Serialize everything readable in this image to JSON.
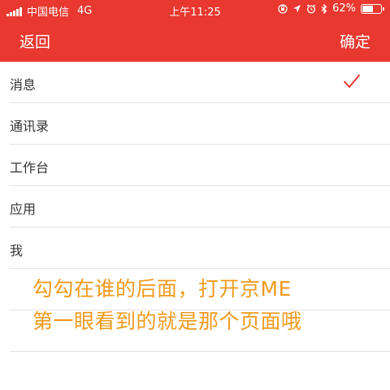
{
  "status_bar": {
    "carrier": "中国电信",
    "network": "4G",
    "time": "上午11:25",
    "battery": "62%",
    "battery_level": 0.62,
    "icons": [
      "signal-icon",
      "lock-rotation-icon",
      "location-icon",
      "alarm-icon",
      "bluetooth-icon",
      "battery-icon"
    ]
  },
  "nav": {
    "back_label": "返回",
    "confirm_label": "确定",
    "accent_color": "#e8382f"
  },
  "list": {
    "items": [
      {
        "label": "消息",
        "checked": true
      },
      {
        "label": "通讯录",
        "checked": false
      },
      {
        "label": "工作台",
        "checked": false
      },
      {
        "label": "应用",
        "checked": false
      },
      {
        "label": "我",
        "checked": false
      }
    ],
    "check_color": "#e8382f"
  },
  "overlay": {
    "line1": "勾勾在谁的后面，打开京ME",
    "line2": "第一眼看到的就是那个页面哦",
    "color": "#f09a1e"
  }
}
